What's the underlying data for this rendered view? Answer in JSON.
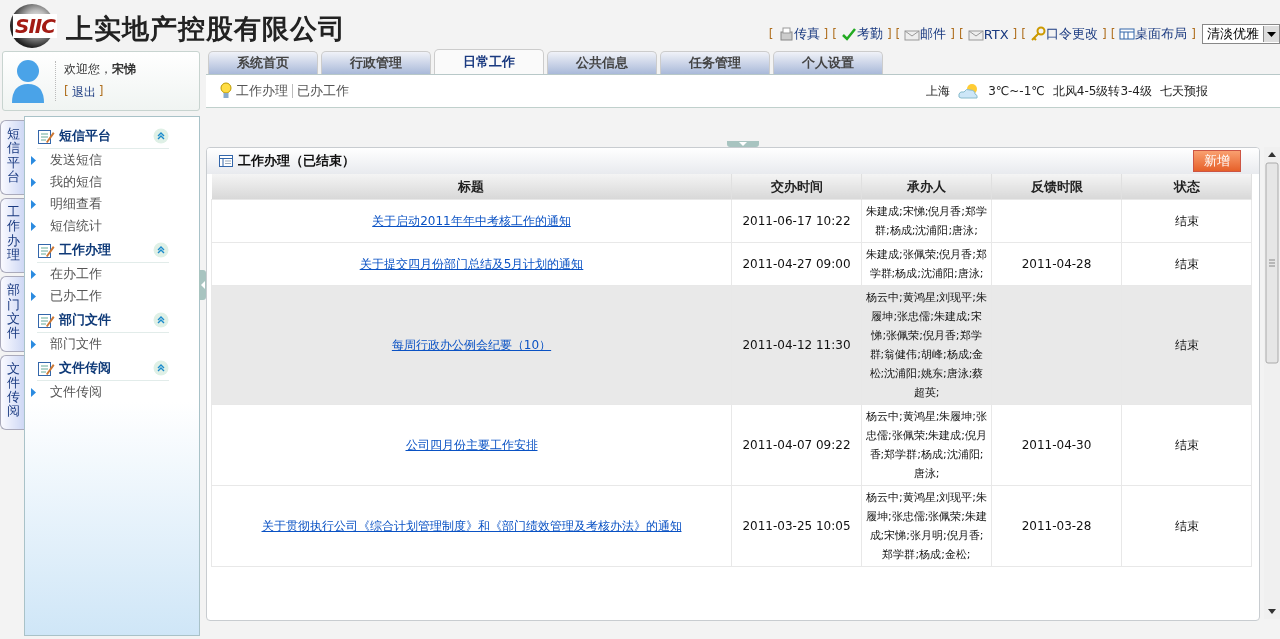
{
  "header": {
    "logo_text": "SIIC",
    "company_name": "上实地产控股有限公司",
    "links": [
      {
        "open": "[",
        "label": "传真",
        "kind": "fax",
        "close": "]"
      },
      {
        "open": "[",
        "label": "考勤",
        "kind": "check",
        "close": "]"
      },
      {
        "open": "[",
        "label": "邮件",
        "kind": "mail",
        "close": "]"
      },
      {
        "open": "[",
        "label": "RTX",
        "kind": "mail",
        "close": "]"
      },
      {
        "open": "[",
        "label": "口令更改",
        "kind": "key",
        "close": "]"
      },
      {
        "open": "[",
        "label": "桌面布局",
        "kind": "grid",
        "close": "]"
      }
    ],
    "theme_select": {
      "value": "清淡优雅"
    }
  },
  "user": {
    "greeting": "欢迎您，",
    "name": "宋悌",
    "logout_open": "[",
    "logout": "退出",
    "logout_close": "]"
  },
  "tabs": [
    {
      "label": "系统首页",
      "selected": false
    },
    {
      "label": "行政管理",
      "selected": false
    },
    {
      "label": "日常工作",
      "selected": true
    },
    {
      "label": "公共信息",
      "selected": false
    },
    {
      "label": "任务管理",
      "selected": false
    },
    {
      "label": "个人设置",
      "selected": false
    }
  ],
  "subnav": [
    "工作办理",
    "已办工作"
  ],
  "weather": {
    "city": "上海",
    "temperature": "3℃~-1℃",
    "wind": "北风4-5级转3-4级",
    "forecast_link": "七天预报"
  },
  "side_tabs": [
    "短信平台",
    "工作办理",
    "部门文件",
    "文件传阅"
  ],
  "sidebar": {
    "groups": [
      {
        "title": "短信平台",
        "items": [
          "发送短信",
          "我的短信",
          "明细查看",
          "短信统计"
        ]
      },
      {
        "title": "工作办理",
        "items": [
          "在办工作",
          "已办工作"
        ]
      },
      {
        "title": "部门文件",
        "items": [
          "部门文件"
        ]
      },
      {
        "title": "文件传阅",
        "items": [
          "文件传阅"
        ]
      }
    ]
  },
  "panel": {
    "title": "工作办理（已结束）",
    "add_button": "新增",
    "table": {
      "columns": [
        "标题",
        "交办时间",
        "承办人",
        "反馈时限",
        "状态"
      ],
      "rows": [
        {
          "title": "关于启动2011年年中考核工作的通知",
          "assigned": "2011-06-17 10:22",
          "handlers": "朱建成;宋悌;倪月香;郑学群;杨成;沈浦阳;唐泳;",
          "deadline": "",
          "status": "结束",
          "selected": false
        },
        {
          "title": "关于提交四月份部门总结及5月计划的通知",
          "assigned": "2011-04-27 09:00",
          "handlers": "朱建成;张佩荣;倪月香;郑学群;杨成;沈浦阳;唐泳;",
          "deadline": "2011-04-28",
          "status": "结束",
          "selected": false
        },
        {
          "title": "每周行政办公例会纪要（10）",
          "assigned": "2011-04-12 11:30",
          "handlers": "杨云中;黄鸿星;刘现平;朱履坤;张忠儒;朱建成;宋悌;张佩荣;倪月香;郑学群;翁健伟;胡峰;杨成;金松;沈浦阳;姚东;唐泳;蔡超英;",
          "deadline": "",
          "status": "结束",
          "selected": true
        },
        {
          "title": "公司四月份主要工作安排",
          "assigned": "2011-04-07 09:22",
          "handlers": "杨云中;黄鸿星;朱履坤;张忠儒;张佩荣;朱建成;倪月香;郑学群;杨成;沈浦阳;唐泳;",
          "deadline": "2011-04-30",
          "status": "结束",
          "selected": false
        },
        {
          "title": "关于贯彻执行公司《综合计划管理制度》和《部门绩效管理及考核办法》的通知",
          "assigned": "2011-03-25 10:05",
          "handlers": "杨云中;黄鸿星;刘现平;朱履坤;张忠儒;张佩荣;朱建成;宋悌;张月明;倪月香;郑学群;杨成;金松;",
          "deadline": "2011-03-28",
          "status": "结束",
          "selected": false
        }
      ]
    }
  }
}
